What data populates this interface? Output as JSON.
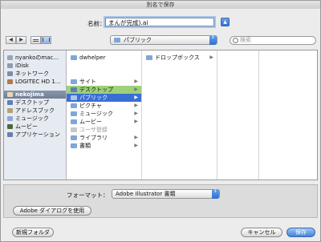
{
  "window": {
    "title": "別名で保存"
  },
  "name_row": {
    "label": "名前：",
    "value": "まんが完成).ai",
    "expand_arrow": "▲"
  },
  "toolbar": {
    "back_glyph": "◀",
    "forward_glyph": "▶",
    "location": "パブリック",
    "popup_arrow": "⇕",
    "search_placeholder": "検索"
  },
  "sidebar": {
    "devices": [
      {
        "label": "nyankoのmac…",
        "icon": "computer-icon",
        "color": "#9aa6b6"
      },
      {
        "label": "iDisk",
        "icon": "idisk-icon",
        "color": "#8c9cb4"
      },
      {
        "label": "ネットワーク",
        "icon": "network-icon",
        "color": "#7d8fa8"
      },
      {
        "label": "LOGITEC HD 1…",
        "icon": "disk-icon",
        "color": "#b07a4a"
      }
    ],
    "places": [
      {
        "label": "nekojima",
        "icon": "home-icon",
        "color": "#e7d8b8",
        "selected": true
      },
      {
        "label": "デスクトップ",
        "icon": "desktop-icon",
        "color": "#5f7fb8"
      },
      {
        "label": "アドレスブック",
        "icon": "address-book-icon",
        "color": "#b8a078"
      },
      {
        "label": "ミュージック",
        "icon": "music-icon",
        "color": "#8fa7d8"
      },
      {
        "label": "ムービー",
        "icon": "movies-icon",
        "color": "#4a6a3a"
      },
      {
        "label": "アプリケーション",
        "icon": "applications-icon",
        "color": "#6b7fa8"
      }
    ]
  },
  "column1": [
    {
      "label": "dwhelper",
      "icon": "folder-icon",
      "style": "",
      "arrow": ""
    },
    {
      "label": "サイト",
      "icon": "sites-folder-icon",
      "style": "",
      "arrow": "▶"
    },
    {
      "label": "デスクトップ",
      "icon": "desktop-folder-icon",
      "style": "hl-green",
      "arrow": "▶"
    },
    {
      "label": "パブリック",
      "icon": "public-folder-icon",
      "style": "hl-blue",
      "arrow": "▶"
    },
    {
      "label": "ピクチャ",
      "icon": "pictures-folder-icon",
      "style": "",
      "arrow": "▶"
    },
    {
      "label": "ミュージック",
      "icon": "music-folder-icon",
      "style": "",
      "arrow": "▶"
    },
    {
      "label": "ムービー",
      "icon": "movies-folder-icon",
      "style": "",
      "arrow": "▶"
    },
    {
      "label": "ユーザ登録",
      "icon": "registration-icon",
      "style": "dim",
      "arrow": ""
    },
    {
      "label": "ライブラリ",
      "icon": "library-folder-icon",
      "style": "",
      "arrow": "▶"
    },
    {
      "label": "書類",
      "icon": "documents-folder-icon",
      "style": "",
      "arrow": "▶"
    }
  ],
  "column2": [
    {
      "label": "ドロップボックス",
      "icon": "dropbox-folder-icon",
      "arrow": "▶"
    }
  ],
  "format": {
    "label": "フォーマット：",
    "value": "Adobe Illustrator 書類",
    "arrow": "⇕"
  },
  "buttons": {
    "adobe_dialog": "Adobe ダイアログを使用",
    "new_folder": "新規フォルダ",
    "cancel": "キャンセル",
    "save": "保存"
  }
}
